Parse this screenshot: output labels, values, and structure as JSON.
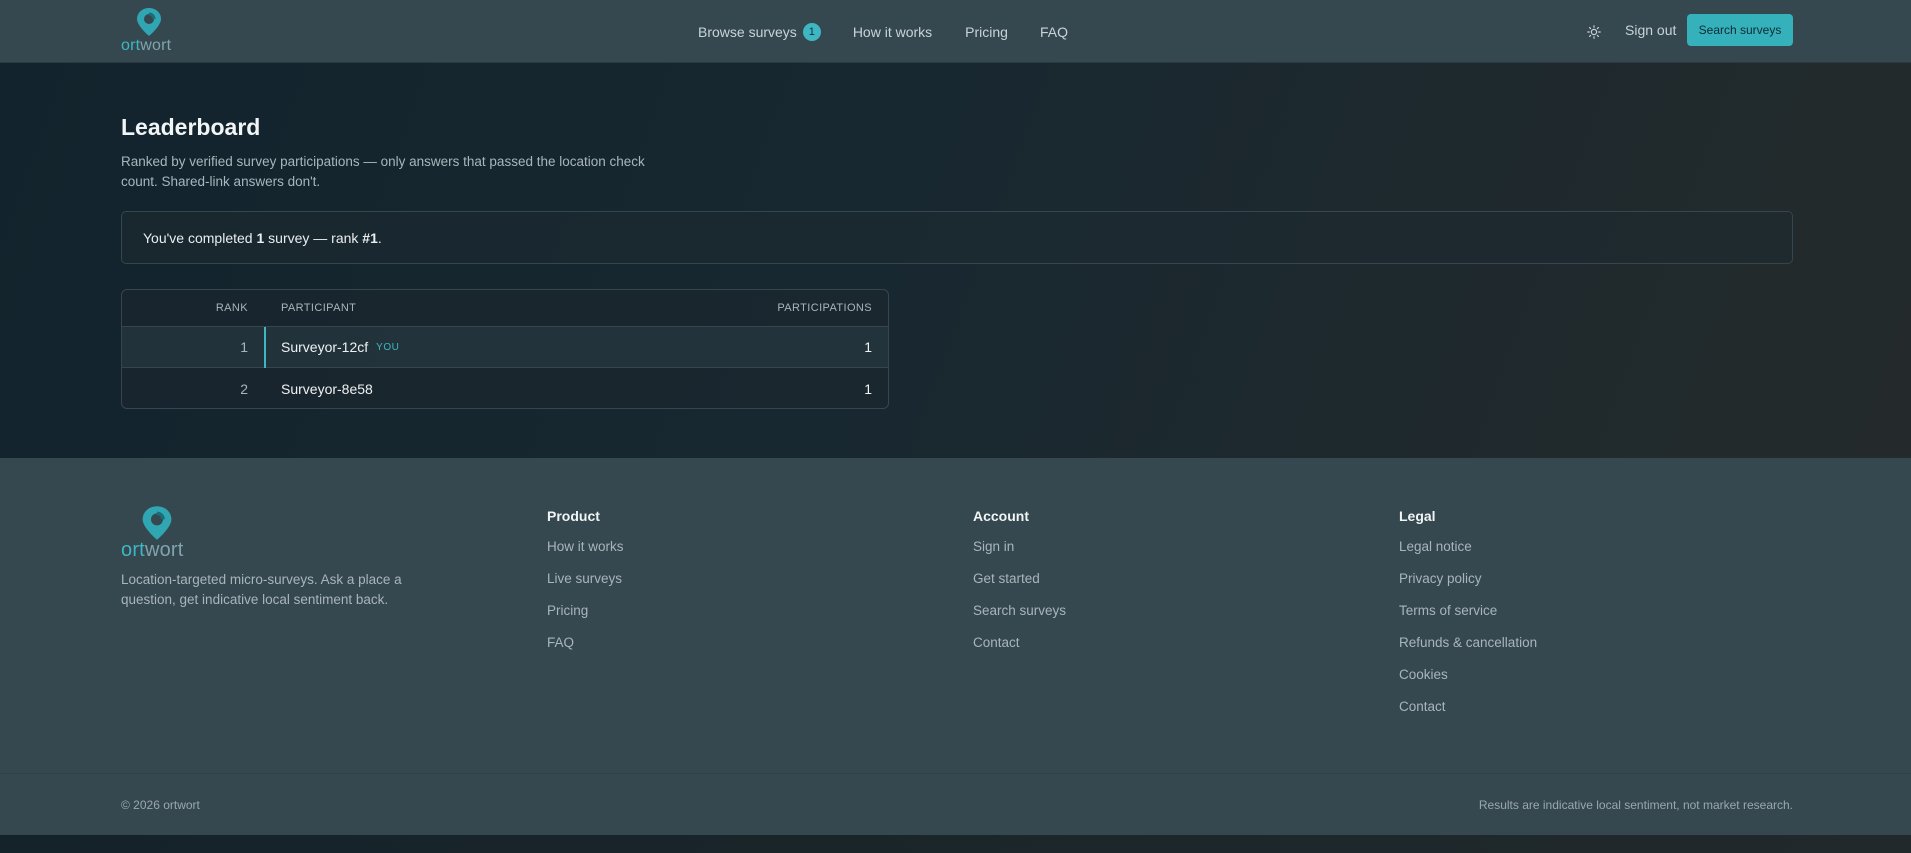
{
  "brand": {
    "name_part1": "ort",
    "name_part2": "wort",
    "accent": "#3fb7c2"
  },
  "header": {
    "nav": [
      {
        "label": "Browse surveys",
        "badge": "1"
      },
      {
        "label": "How it works"
      },
      {
        "label": "Pricing"
      },
      {
        "label": "FAQ"
      }
    ],
    "theme_icon": "sun-icon",
    "sign_out": "Sign out",
    "search_button": "Search surveys"
  },
  "main": {
    "title": "Leaderboard",
    "subtitle": "Ranked by verified survey participations — only answers that passed the location check count. Shared-link answers don't.",
    "rank_summary": {
      "prefix": "You've completed ",
      "count": "1",
      "middle": " survey — rank ",
      "rank": "#1",
      "suffix": "."
    },
    "table": {
      "headers": {
        "rank": "RANK",
        "participant": "PARTICIPANT",
        "participations": "PARTICIPATIONS"
      },
      "rows": [
        {
          "rank": "1",
          "participant": "Surveyor-12cf",
          "tag": "YOU",
          "participations": "1"
        },
        {
          "rank": "2",
          "participant": "Surveyor-8e58",
          "participations": "1"
        }
      ]
    }
  },
  "footer": {
    "tagline": "Location-targeted micro-surveys. Ask a place a question, get indicative local sentiment back.",
    "columns": [
      {
        "title": "Product",
        "links": [
          "How it works",
          "Live surveys",
          "Pricing",
          "FAQ"
        ]
      },
      {
        "title": "Account",
        "links": [
          "Sign in",
          "Get started",
          "Search surveys",
          "Contact"
        ]
      },
      {
        "title": "Legal",
        "links": [
          "Legal notice",
          "Privacy policy",
          "Terms of service",
          "Refunds & cancellation",
          "Cookies",
          "Contact"
        ]
      }
    ],
    "copyright": "© 2026 ortwort",
    "disclaimer": "Results are indicative local sentiment, not market research."
  }
}
